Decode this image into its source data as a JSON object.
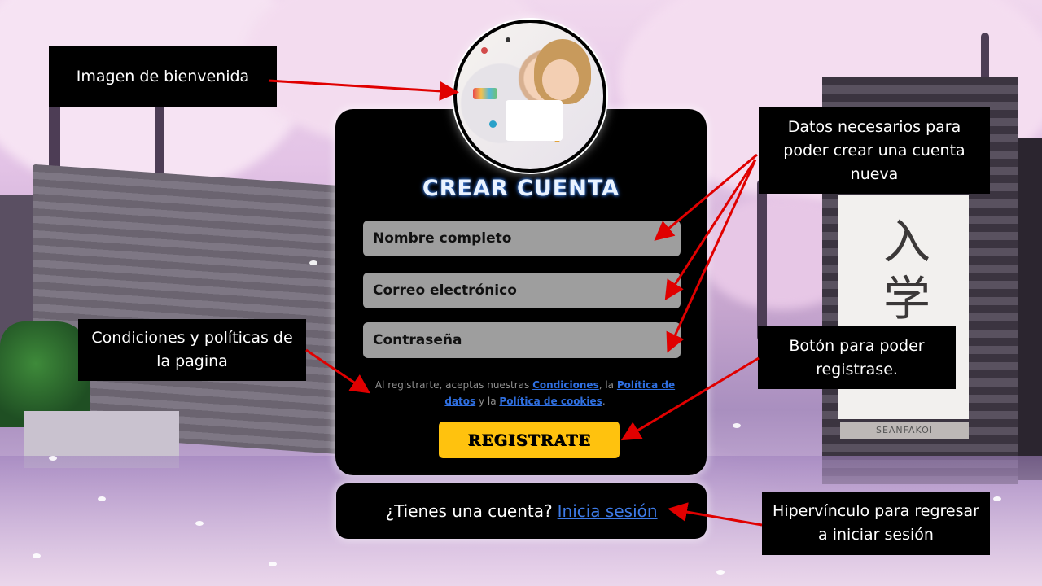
{
  "annotations": {
    "welcome_image": "Imagen de bienvenida",
    "conditions_l1": "Condiciones y políticas de",
    "conditions_l2": "la pagina",
    "data_l1": "Datos necesarios para",
    "data_l2": "poder crear una cuenta",
    "data_l3": "nueva",
    "button_l1": "Botón para poder",
    "button_l2": "registrase.",
    "link_l1": "Hipervínculo para regresar",
    "link_l2": "a iniciar sesión"
  },
  "form": {
    "title": "CREAR CUENTA",
    "fields": {
      "name_placeholder": "Nombre completo",
      "email_placeholder": "Correo electrónico",
      "password_placeholder": "Contraseña"
    },
    "terms": {
      "prefix": "Al registrarte, aceptas nuestras",
      "conditions_link": "Condiciones",
      "sep1": ", la",
      "data_policy_link": "Política de datos",
      "sep2": "y la",
      "cookie_policy_link": "Política de cookies",
      "suffix": "."
    },
    "register_button": "REGISTRATE"
  },
  "login_prompt": {
    "text": "¿Tienes una cuenta?",
    "link": "Inicia sesión"
  },
  "background": {
    "sign_text": "SEANFAKOI"
  },
  "colors": {
    "accent_button": "#ffc20e",
    "link": "#2f6fe0",
    "arrow": "#e00000"
  }
}
